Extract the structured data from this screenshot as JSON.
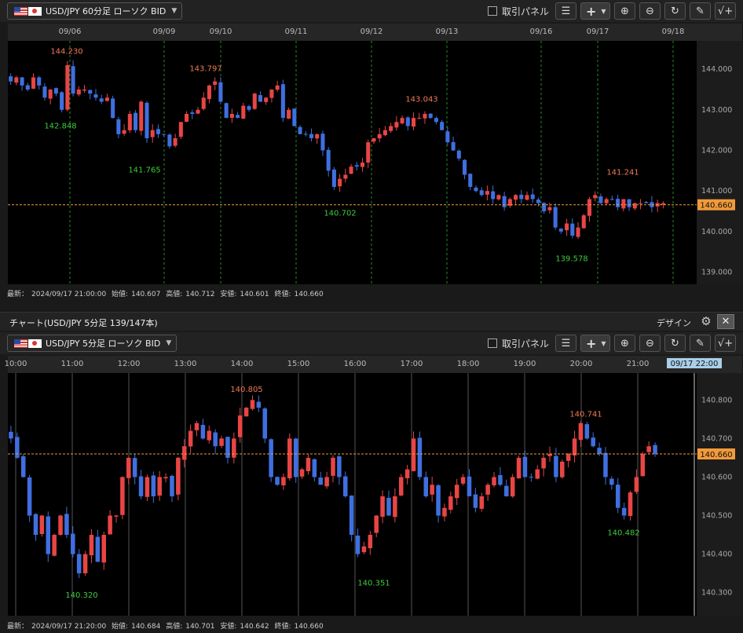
{
  "top": {
    "symbol_label": "USD/JPY 60分足 ローソク BID",
    "checkbox_label": "取引パネル",
    "status": {
      "latest_label": "最新：",
      "latest_time": "2024/09/17 21:00:00",
      "open_label": "始値:",
      "open": "140.607",
      "high_label": "高値:",
      "high": "140.712",
      "low_label": "安値:",
      "low": "140.601",
      "close_label": "終値:",
      "close": "140.660"
    }
  },
  "middle": {
    "title": "チャート(USD/JPY 5分足 139/147本)",
    "design_label": "デザイン"
  },
  "bottom": {
    "symbol_label": "USD/JPY 5分足 ローソク BID",
    "checkbox_label": "取引パネル",
    "status": {
      "latest_label": "最新：",
      "latest_time": "2024/09/17 21:20:00",
      "open_label": "始値:",
      "open": "140.684",
      "high_label": "高値:",
      "high": "140.701",
      "low_label": "安値:",
      "low": "140.642",
      "close_label": "終値:",
      "close": "140.660"
    }
  },
  "icons": {
    "flag_us": "us-flag-icon",
    "flag_jp": "japan-flag-icon",
    "drawing_list": "drawing-list-icon",
    "crosshair": "crosshair-icon",
    "zoom_in": "zoom-in-icon",
    "zoom_out": "zoom-out-icon",
    "refresh": "refresh-icon",
    "pen": "pen-icon",
    "indicator": "indicator-icon",
    "gear": "gear-icon",
    "close": "close-icon"
  },
  "colors": {
    "up": "#e84545",
    "down": "#3f6fe0",
    "high_label": "#f07a50",
    "low_label": "#3ecc3e",
    "price_tag": "#f29a3a",
    "grid_v": "#2a8a2a",
    "background": "#000000"
  },
  "chart_data": [
    {
      "type": "candlestick",
      "name": "USD/JPY 60分足 ローソク BID",
      "x_ticks": [
        "09/06",
        "09/09",
        "09/10",
        "09/11",
        "09/12",
        "09/13",
        "09/16",
        "09/17",
        "09/18"
      ],
      "y_ticks": [
        "144.000",
        "143.000",
        "142.000",
        "141.000",
        "140.000",
        "139.000"
      ],
      "ylim": [
        138.7,
        144.7
      ],
      "current_price": "140.660",
      "annotations": [
        {
          "text": "144.230",
          "kind": "high",
          "value": 144.23
        },
        {
          "text": "142.848",
          "kind": "low",
          "value": 142.848
        },
        {
          "text": "143.797",
          "kind": "high",
          "value": 143.797
        },
        {
          "text": "141.765",
          "kind": "low",
          "value": 141.765
        },
        {
          "text": "140.702",
          "kind": "low",
          "value": 140.702
        },
        {
          "text": "143.043",
          "kind": "high",
          "value": 143.043
        },
        {
          "text": "139.578",
          "kind": "low",
          "value": 139.578
        },
        {
          "text": "141.241",
          "kind": "high",
          "value": 141.241
        }
      ],
      "series": [
        {
          "values": [
            143.7,
            143.8,
            143.6,
            143.5,
            143.8,
            143.6,
            143.3,
            143.5,
            143.4,
            143.0,
            144.1,
            143.4,
            143.5,
            143.5,
            143.4,
            143.3,
            143.2,
            143.3,
            142.8,
            142.4,
            142.5,
            142.9,
            142.5,
            143.2,
            142.3,
            142.5,
            142.4,
            142.4,
            142.1,
            142.3,
            142.7,
            142.9,
            142.9,
            143.0,
            143.3,
            143.6,
            143.7,
            143.2,
            142.8,
            142.9,
            142.8,
            143.1,
            143.0,
            143.4,
            143.2,
            143.3,
            143.5,
            143.6,
            142.8,
            143.0,
            142.6,
            142.4,
            142.4,
            142.3,
            142.4,
            142.0,
            141.5,
            141.1,
            141.3,
            141.4,
            141.6,
            141.6,
            141.7,
            142.2,
            142.3,
            142.4,
            142.5,
            142.6,
            142.7,
            142.8,
            142.6,
            142.8,
            142.8,
            142.9,
            142.8,
            142.7,
            142.5,
            142.2,
            142.0,
            141.8,
            141.4,
            141.1,
            141.0,
            140.9,
            141.0,
            140.8,
            140.9,
            140.6,
            140.8,
            140.9,
            140.8,
            140.9,
            140.8,
            140.7,
            140.5,
            140.6,
            140.1,
            140.0,
            140.2,
            139.9,
            140.1,
            140.4,
            140.8,
            140.9,
            140.7,
            140.8,
            140.8,
            140.6,
            140.8,
            140.6,
            140.7,
            140.7,
            140.7,
            140.6,
            140.7,
            140.7
          ]
        }
      ]
    },
    {
      "type": "candlestick",
      "name": "USD/JPY 5分足 ローソク BID",
      "x_ticks": [
        "10:00",
        "11:00",
        "12:00",
        "13:00",
        "14:00",
        "15:00",
        "16:00",
        "17:00",
        "18:00",
        "19:00",
        "20:00",
        "21:00"
      ],
      "x_current": "09/17 22:00",
      "y_ticks": [
        "140.800",
        "140.700",
        "140.600",
        "140.500",
        "140.400",
        "140.300"
      ],
      "ylim": [
        140.24,
        140.87
      ],
      "current_price": "140.660",
      "annotations": [
        {
          "text": "140.805",
          "kind": "high",
          "value": 140.805
        },
        {
          "text": "140.320",
          "kind": "low",
          "value": 140.32
        },
        {
          "text": "140.351",
          "kind": "low",
          "value": 140.351
        },
        {
          "text": "140.741",
          "kind": "high",
          "value": 140.741
        },
        {
          "text": "140.482",
          "kind": "low",
          "value": 140.482
        }
      ],
      "series": [
        {
          "values": [
            140.7,
            140.65,
            140.6,
            140.5,
            140.45,
            140.5,
            140.4,
            140.45,
            140.5,
            140.45,
            140.4,
            140.35,
            140.4,
            140.45,
            140.38,
            140.45,
            140.5,
            140.5,
            140.6,
            140.65,
            140.6,
            140.55,
            140.6,
            140.55,
            140.6,
            140.6,
            140.55,
            140.65,
            140.68,
            140.72,
            140.74,
            140.7,
            140.72,
            140.68,
            140.7,
            140.65,
            140.7,
            140.76,
            140.78,
            140.8,
            140.78,
            140.7,
            140.6,
            140.58,
            140.6,
            140.7,
            140.6,
            140.62,
            140.65,
            140.6,
            140.58,
            140.6,
            140.65,
            140.6,
            140.55,
            140.45,
            140.4,
            140.42,
            140.45,
            140.5,
            140.55,
            140.5,
            140.55,
            140.6,
            140.62,
            140.7,
            140.6,
            140.55,
            140.58,
            140.5,
            140.52,
            140.55,
            140.58,
            140.6,
            140.55,
            140.52,
            140.55,
            140.58,
            140.6,
            140.58,
            140.55,
            140.6,
            140.65,
            140.6,
            140.6,
            140.62,
            140.65,
            140.66,
            140.6,
            140.64,
            140.66,
            140.7,
            140.74,
            140.7,
            140.68,
            140.66,
            140.6,
            140.58,
            140.52,
            140.5,
            140.56,
            140.6,
            140.66,
            140.68,
            140.66
          ]
        }
      ]
    }
  ]
}
